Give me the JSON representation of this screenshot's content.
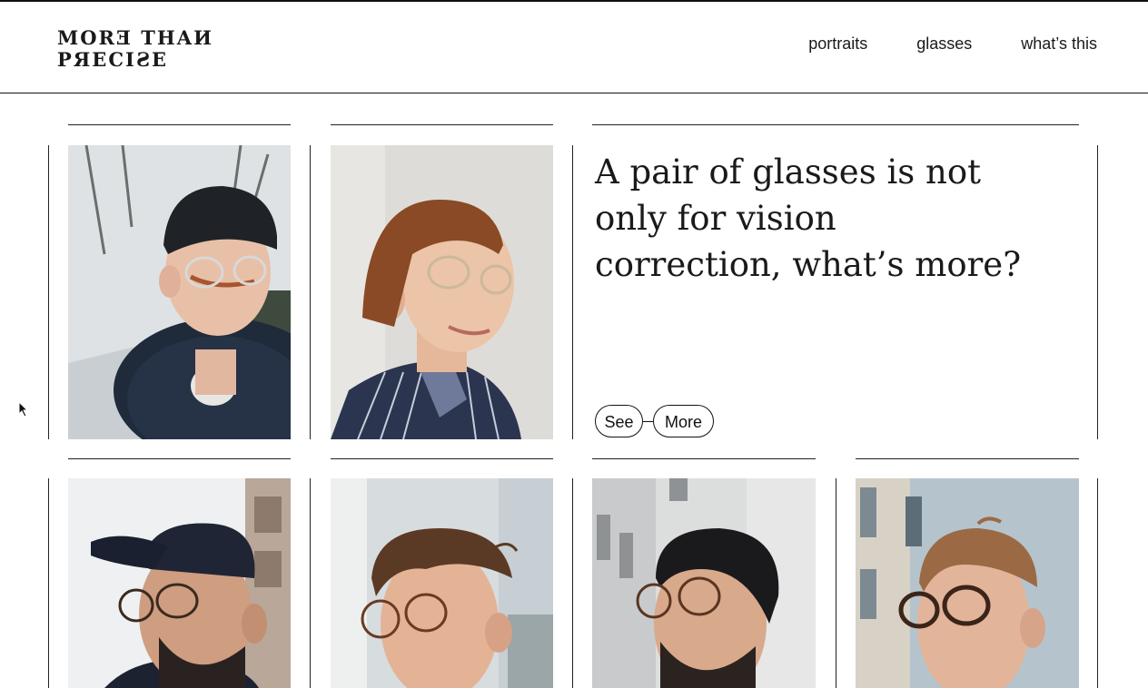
{
  "header": {
    "logo_line1": "MORƎ THAИ",
    "logo_line2": "PЯECIƧE",
    "nav": [
      "portraits",
      "glasses",
      "what’s this"
    ]
  },
  "feature": {
    "headline": "A pair of glasses is not only for vision correction, what’s more?",
    "see_label": "See",
    "more_label": "More"
  },
  "portraits": [
    {
      "name": "portrait-beanie-man",
      "hat": "beanie",
      "glasses": "clear"
    },
    {
      "name": "portrait-striped-jacket-man",
      "hat": "none",
      "glasses": "clear"
    },
    {
      "name": "portrait-cap-man",
      "hat": "cap",
      "glasses": "tortoise"
    },
    {
      "name": "portrait-curly-hair-man",
      "hat": "none",
      "glasses": "tortoise"
    },
    {
      "name": "portrait-round-glasses-man",
      "hat": "none",
      "glasses": "tortoise"
    },
    {
      "name": "portrait-tortoise-glasses-man",
      "hat": "none",
      "glasses": "tortoise"
    }
  ],
  "colors": {
    "text": "#1a1a1a",
    "background": "#ffffff",
    "rule": "#222222"
  }
}
